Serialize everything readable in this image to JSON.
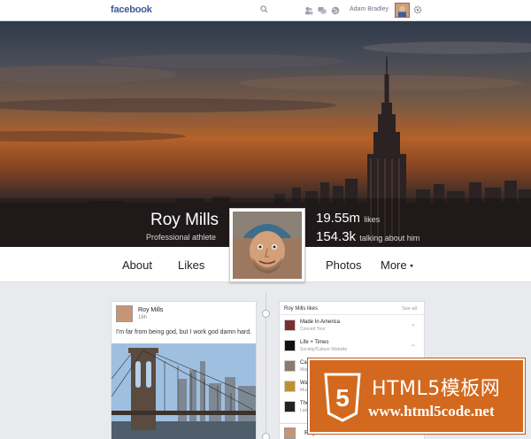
{
  "topbar": {
    "brand": "facebook",
    "user_name": "Adam Bradley",
    "icons": [
      "search-icon",
      "friends-icon",
      "messages-icon",
      "globe-icon",
      "gear-icon"
    ]
  },
  "profile": {
    "name": "Roy Mills",
    "tagline": "Professional athlete",
    "likes_count": "19.55m",
    "likes_label": "likes",
    "talking_count": "154.3k",
    "talking_label": "talking about him"
  },
  "tabs": [
    {
      "label": "About"
    },
    {
      "label": "Likes"
    },
    {
      "label": "Photos"
    },
    {
      "label": "More"
    }
  ],
  "post": {
    "author": "Roy Mills",
    "time": "16h",
    "text": "I'm far from being god, but I work god damn hard."
  },
  "likes_box": {
    "title": "Roy Mills likes",
    "see_all": "See all",
    "items": [
      {
        "name": "Made In America",
        "category": "Concert Tour"
      },
      {
        "name": "Life + Times",
        "category": "Society/Culture Website"
      },
      {
        "name": "Can",
        "category": "Mai"
      },
      {
        "name": "Wat",
        "category": "Musi"
      },
      {
        "name": "The",
        "category": "Late"
      }
    ]
  },
  "post2": {
    "author": "Roy"
  },
  "watermark": {
    "title": "HTML5模板网",
    "url": "www.html5code.net",
    "badge": "5"
  },
  "colors": {
    "brand": "#3b5998",
    "watermark": "#d2691e"
  }
}
